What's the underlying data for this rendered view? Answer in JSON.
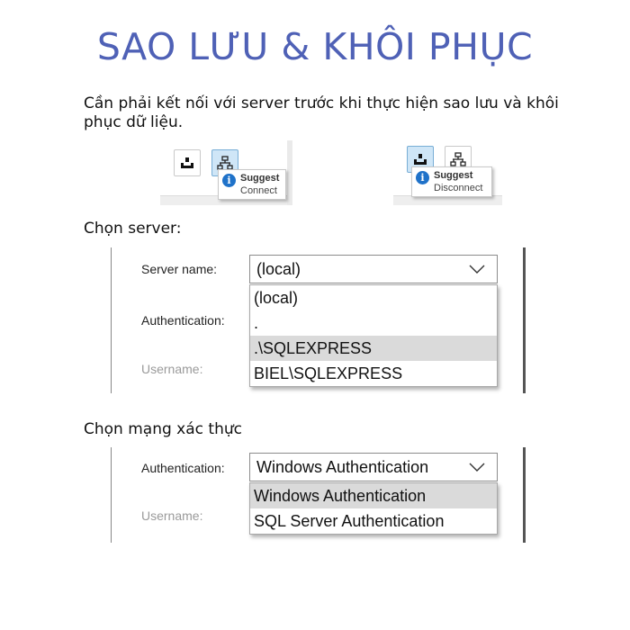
{
  "title": "SAO LƯU & KHÔI PHỤC",
  "intro": "Cần phải kết nối với server trước khi thực hiện sao lưu và khôi phục dữ liệu.",
  "connect_tip": {
    "title": "Suggest",
    "text": "Connect"
  },
  "disconnect_tip": {
    "title": "Suggest",
    "text": "Disconnect"
  },
  "server_section": {
    "label": "Chọn server:",
    "server_name_label": "Server name:",
    "server_name_value": "(local)",
    "authentication_label": "Authentication:",
    "username_label": "Username:",
    "options": [
      "(local)",
      ".",
      ".\\SQLEXPRESS",
      "BIEL\\SQLEXPRESS"
    ],
    "highlighted": ".\\SQLEXPRESS"
  },
  "auth_section": {
    "label": "Chọn mạng xác thực",
    "authentication_label": "Authentication:",
    "authentication_value": "Windows Authentication",
    "username_label": "Username:",
    "options": [
      "Windows Authentication",
      "SQL Server Authentication"
    ],
    "highlighted": "Windows Authentication"
  },
  "icons": [
    "disconnect-icon",
    "connect-network-icon",
    "info-icon",
    "chevron-down-icon"
  ],
  "colors": {
    "title": "#4f61b6",
    "active_button": "#cfe6f7",
    "info": "#1f72c9",
    "highlight": "#dadada"
  }
}
